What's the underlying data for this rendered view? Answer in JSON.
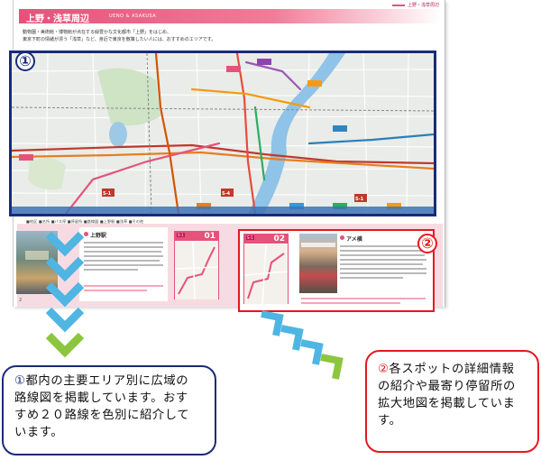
{
  "page": {
    "running_head": "上野・浅草周辺",
    "title": "上野・浅草周辺",
    "title_en": "UENO & ASAKUSA",
    "intro_line1": "動物園・美術館・博物館が点在する緑豊かな文化都市「上野」をはじめ、",
    "intro_line2": "東京下町の情緒が漂う「浅草」など、身近で東京を散策したい人には、おすすめのエリアです。",
    "legend": "■地区 ■名所 ■バス停 ■停留所 ■路線図 ■上野駅 ■浅草 ■その他",
    "page_number": "2"
  },
  "map": {
    "badge": "①",
    "route_badges": [
      "S-1",
      "S-1",
      "S-4"
    ]
  },
  "spots": {
    "ueno": {
      "title": "上野駅"
    },
    "card_01": {
      "label": "01",
      "tag": "S-1"
    },
    "card_02": {
      "label": "02",
      "tag": "S-1"
    },
    "ameyoko": {
      "title": "アメ横"
    },
    "badge": "②"
  },
  "callouts": {
    "left": {
      "number": "①",
      "text": "都内の主要エリア別に広域の\n路線図を掲載しています。おす\nすめ２０路線を色別に紹介して\nいます。"
    },
    "right": {
      "number": "②",
      "text": "各スポットの詳細情報\nの紹介や最寄り停留所の\n拡大地図を掲載していま\nす。"
    }
  },
  "colors": {
    "accent_pink": "#e5527a",
    "frame_navy": "#1a2a7a",
    "frame_red": "#e8161f",
    "arrow_blue": "#4fb5e3",
    "arrow_green": "#8cc63f"
  }
}
